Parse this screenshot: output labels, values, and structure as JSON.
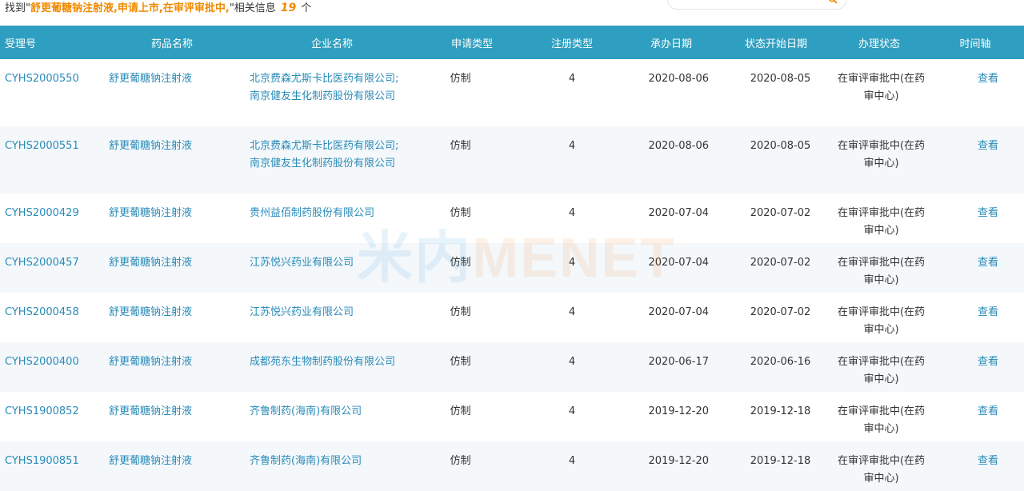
{
  "summary": {
    "prefix": "找到\"",
    "query": "舒更葡糖钠注射液,申请上市,在审评审批中,",
    "suffix": "\"相关信息",
    "count": "19",
    "unit": "个"
  },
  "headers": [
    "受理号",
    "药品名称",
    "企业名称",
    "申请类型",
    "注册类型",
    "承办日期",
    "状态开始日期",
    "办理状态",
    "时间轴"
  ],
  "rows": [
    {
      "id": "CYHS2000550",
      "drug": "舒更葡糖钠注射液",
      "company": "北京费森尤斯卡比医药有限公司;南京健友生化制药股份有限公司",
      "apply": "仿制",
      "reg": "4",
      "accept": "2020-08-06",
      "start": "2020-08-05",
      "status": "在审评审批中(在药审中心)",
      "action": "查看"
    },
    {
      "id": "CYHS2000551",
      "drug": "舒更葡糖钠注射液",
      "company": "北京费森尤斯卡比医药有限公司;南京健友生化制药股份有限公司",
      "apply": "仿制",
      "reg": "4",
      "accept": "2020-08-06",
      "start": "2020-08-05",
      "status": "在审评审批中(在药审中心)",
      "action": "查看"
    },
    {
      "id": "CYHS2000429",
      "drug": "舒更葡糖钠注射液",
      "company": "贵州益佰制药股份有限公司",
      "apply": "仿制",
      "reg": "4",
      "accept": "2020-07-04",
      "start": "2020-07-02",
      "status": "在审评审批中(在药审中心)",
      "action": "查看"
    },
    {
      "id": "CYHS2000457",
      "drug": "舒更葡糖钠注射液",
      "company": "江苏悦兴药业有限公司",
      "apply": "仿制",
      "reg": "4",
      "accept": "2020-07-04",
      "start": "2020-07-02",
      "status": "在审评审批中(在药审中心)",
      "action": "查看"
    },
    {
      "id": "CYHS2000458",
      "drug": "舒更葡糖钠注射液",
      "company": "江苏悦兴药业有限公司",
      "apply": "仿制",
      "reg": "4",
      "accept": "2020-07-04",
      "start": "2020-07-02",
      "status": "在审评审批中(在药审中心)",
      "action": "查看"
    },
    {
      "id": "CYHS2000400",
      "drug": "舒更葡糖钠注射液",
      "company": "成都苑东生物制药股份有限公司",
      "apply": "仿制",
      "reg": "4",
      "accept": "2020-06-17",
      "start": "2020-06-16",
      "status": "在审评审批中(在药审中心)",
      "action": "查看"
    },
    {
      "id": "CYHS1900852",
      "drug": "舒更葡糖钠注射液",
      "company": "齐鲁制药(海南)有限公司",
      "apply": "仿制",
      "reg": "4",
      "accept": "2019-12-20",
      "start": "2019-12-18",
      "status": "在审评审批中(在药审中心)",
      "action": "查看"
    },
    {
      "id": "CYHS1900851",
      "drug": "舒更葡糖钠注射液",
      "company": "齐鲁制药(海南)有限公司",
      "apply": "仿制",
      "reg": "4",
      "accept": "2019-12-20",
      "start": "2019-12-18",
      "status": "在审评审批中(在药审中心)",
      "action": "查看"
    }
  ],
  "watermark": {
    "cn": "米内",
    "en": "MENET"
  },
  "colors": {
    "header_bg": "#2e9fc0",
    "link": "#2a8bb8",
    "highlight": "#f08a00"
  }
}
